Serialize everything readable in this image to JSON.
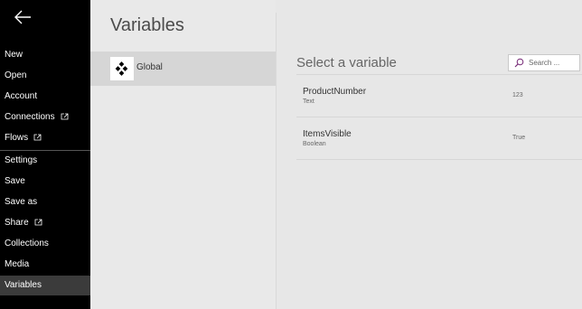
{
  "app": {
    "colors": {
      "nav_bg": "#000000",
      "nav_selected": "#3b3b3b",
      "accent": "#742774"
    }
  },
  "nav": {
    "back_icon": "arrow-left-icon",
    "items": [
      {
        "label": "New"
      },
      {
        "label": "Open"
      },
      {
        "label": "Account"
      },
      {
        "label": "Connections",
        "icon": "open-in-new-icon"
      },
      {
        "label": "Flows",
        "icon": "open-in-new-icon"
      },
      {
        "label": "Settings"
      },
      {
        "label": "Save"
      },
      {
        "label": "Save as"
      },
      {
        "label": "Share",
        "icon": "open-in-new-icon"
      },
      {
        "label": "Collections"
      },
      {
        "label": "Media"
      },
      {
        "label": "Variables",
        "selected": true
      }
    ]
  },
  "middle": {
    "title": "Variables",
    "scopes": [
      {
        "label": "Global",
        "icon": "global-scope-icon",
        "selected": true
      }
    ]
  },
  "main": {
    "heading": "Select a variable",
    "search": {
      "placeholder": "Search ...",
      "value": "",
      "icon": "search-icon"
    },
    "variables": [
      {
        "name": "ProductNumber",
        "type": "Text",
        "value": "123"
      },
      {
        "name": "ItemsVisible",
        "type": "Boolean",
        "value": "True"
      }
    ]
  }
}
